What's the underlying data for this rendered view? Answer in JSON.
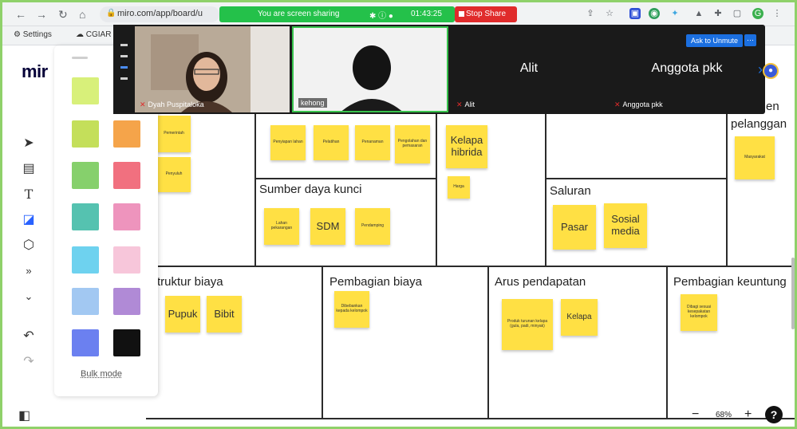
{
  "browser": {
    "url": "miro.com/app/board/u",
    "sharing_text": "You are screen sharing",
    "timer": "01:43:25",
    "stop_share_label": "Stop Share",
    "bookmarks": [
      "Settings",
      "CGIAR"
    ]
  },
  "miro": {
    "logo": "mir",
    "bulk_mode_label": "Bulk mode",
    "palette_colors": [
      "#d8f07a",
      "#c4df5a",
      "#f5a44a",
      "#86d06c",
      "#f1707f",
      "#55c2b0",
      "#ee94bd",
      "#6ed2ef",
      "#f7c6da",
      "#a2c8f2",
      "#b08ad6",
      "#6b80f0",
      "#111111"
    ],
    "zoom_level": "68%",
    "zoom_out": "−",
    "zoom_in": "+",
    "help": "?"
  },
  "zoom": {
    "participants": [
      {
        "name": "Dyah Puspitaloka"
      },
      {
        "name": "kehong"
      },
      {
        "name": "Alit",
        "display": "Alit"
      },
      {
        "name": "Anggota pkk",
        "display": "Anggota pkk"
      }
    ],
    "ask_unmute": "Ask to Unmute"
  },
  "board": {
    "sections": {
      "sumber_daya": "Sumber daya kunci",
      "saluran": "Saluran",
      "pelanggan_partial": "en",
      "pelanggan": "pelanggan",
      "struktur_biaya": "Struktur biaya",
      "pembagian_biaya": "Pembagian biaya",
      "arus_pendapatan": "Arus pendapatan",
      "pembagian_keuntungan": "Pembagian keuntung"
    },
    "stickies": {
      "s1": "Pemerintah",
      "s2": "Penyuluh",
      "s3": "Penyiapan lahan",
      "s4": "Pelatihan",
      "s5": "Penanaman",
      "s6": "Pengolahan dan pemasaran",
      "s7": "Kelapa hibrida",
      "s8": "Harga",
      "s9": "Lahan pekarangan",
      "s10": "SDM",
      "s11": "Pendamping",
      "s12": "Pasar",
      "s13": "Sosial media",
      "s14": "Masyarakat",
      "s15": "Pupuk",
      "s16": "Bibit",
      "s17": "Dibebankan kepada kelompok",
      "s18": "Produk turunan kelapa (gula, padi, minyak)",
      "s19": "Kelapa",
      "s20": "Dibagi sesuai kesepakatan kelompok"
    }
  }
}
